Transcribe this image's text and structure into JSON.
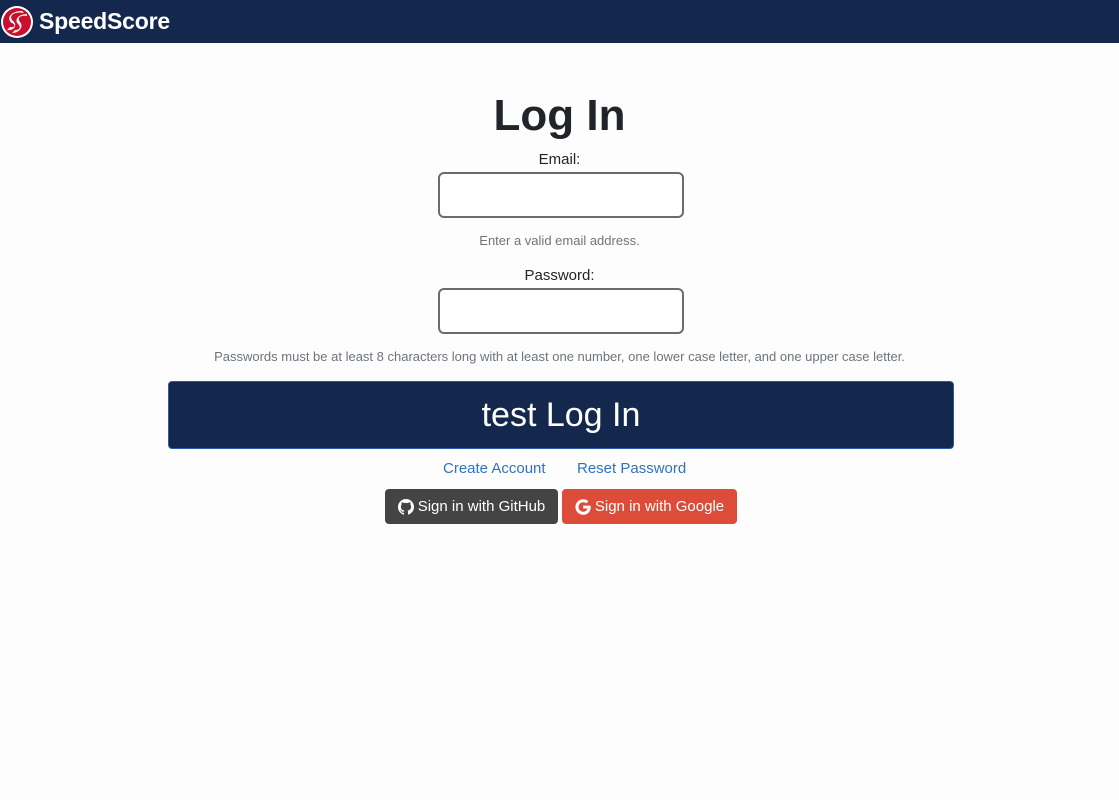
{
  "navbar": {
    "brand": "SpeedScore",
    "logo_icon": "speedscore-logo-icon",
    "background": "#13284c"
  },
  "login": {
    "title": "Log In",
    "email_label": "Email:",
    "email_value": "",
    "email_hint": "Enter a valid email address.",
    "password_label": "Password:",
    "password_value": "",
    "password_hint": "Passwords must be at least 8 characters long with at least one number, one lower case letter, and one upper case letter.",
    "submit_label": "test Log In",
    "create_account": "Create Account",
    "reset_password": "Reset Password",
    "github_label": "Sign in with GitHub",
    "github_icon": "github-icon",
    "google_label": "Sign in with Google",
    "google_icon": "google-icon"
  },
  "colors": {
    "primary": "#13284c",
    "link": "#2f74c0",
    "github": "#444444",
    "google": "#dd4b39"
  }
}
